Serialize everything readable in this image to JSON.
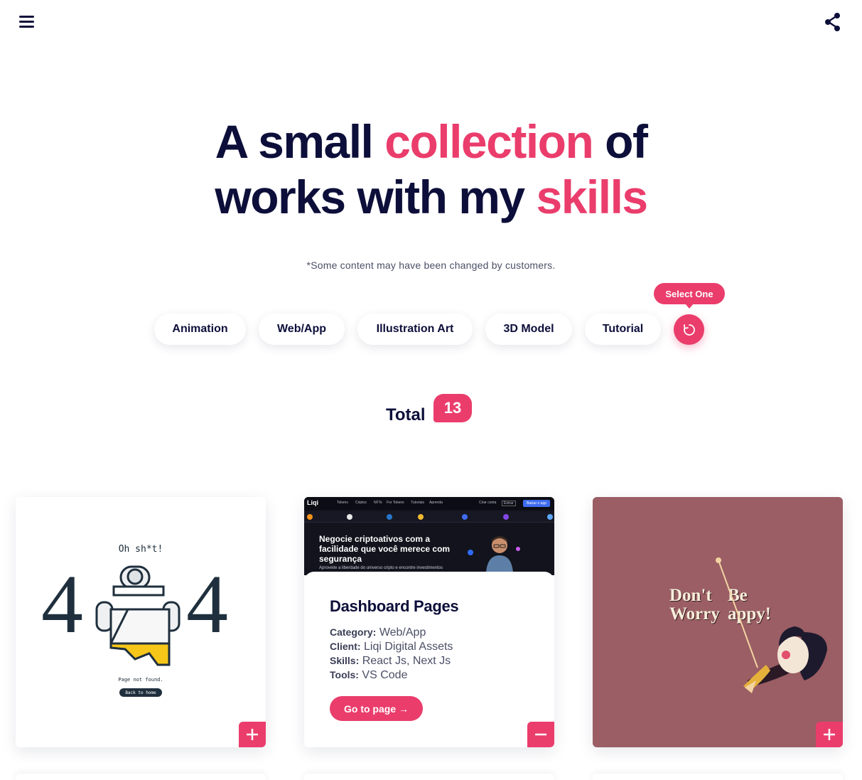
{
  "header": {
    "menu_icon": "hamburger-menu-icon",
    "share_icon": "share-icon"
  },
  "hero": {
    "line1_a": "A small ",
    "line1_accent": "collection",
    "line1_b": " of",
    "line2_a": "works with my ",
    "line2_accent": "skills"
  },
  "note": "*Some content may have been changed by customers.",
  "filters": {
    "items": [
      {
        "label": "Animation"
      },
      {
        "label": "Web/App"
      },
      {
        "label": "Illustration Art"
      },
      {
        "label": "3D Model"
      },
      {
        "label": "Tutorial"
      }
    ],
    "tooltip": "Select One",
    "reset_icon": "refresh-icon"
  },
  "total": {
    "label": "Total",
    "count": "13"
  },
  "cards": [
    {
      "toggle_icon": "plus-icon",
      "art": {
        "oh_text": "Oh sh*t!",
        "digit": "4",
        "not_found": "Page not found.",
        "home_button": "Back to home"
      }
    },
    {
      "toggle_icon": "minus-icon",
      "screenshot": {
        "logo": "Liqi",
        "nav": [
          "Tokens",
          "Criptos",
          "NFTs",
          "For Tokens",
          "Tutoriais",
          "Aprenda"
        ],
        "nav_right": [
          "Criar conta",
          "Entrar"
        ],
        "cta": "Baixar o app",
        "headline": "Negocie criptoativos com a facilidade que você merece com segurança",
        "subtext": "Aproveite a liberdade do universo cripto e encontre investimentos"
      },
      "title": "Dashboard Pages",
      "meta": [
        {
          "key": "Category:",
          "value": "Web/App"
        },
        {
          "key": "Client:",
          "value": "Liqi Digital Assets"
        },
        {
          "key": "Skills:",
          "value": "React Js, Next Js"
        },
        {
          "key": "Tools:",
          "value": "VS Code"
        }
      ],
      "button": "Go to page →"
    },
    {
      "toggle_icon": "plus-icon",
      "art": {
        "left_line1": "Don't",
        "left_line2": "Worry",
        "right_line1": "Be",
        "right_line2": "appy!"
      }
    }
  ],
  "colors": {
    "navy": "#0d0f3a",
    "accent": "#ea3d6c",
    "card3_bg": "#9a5e64"
  }
}
